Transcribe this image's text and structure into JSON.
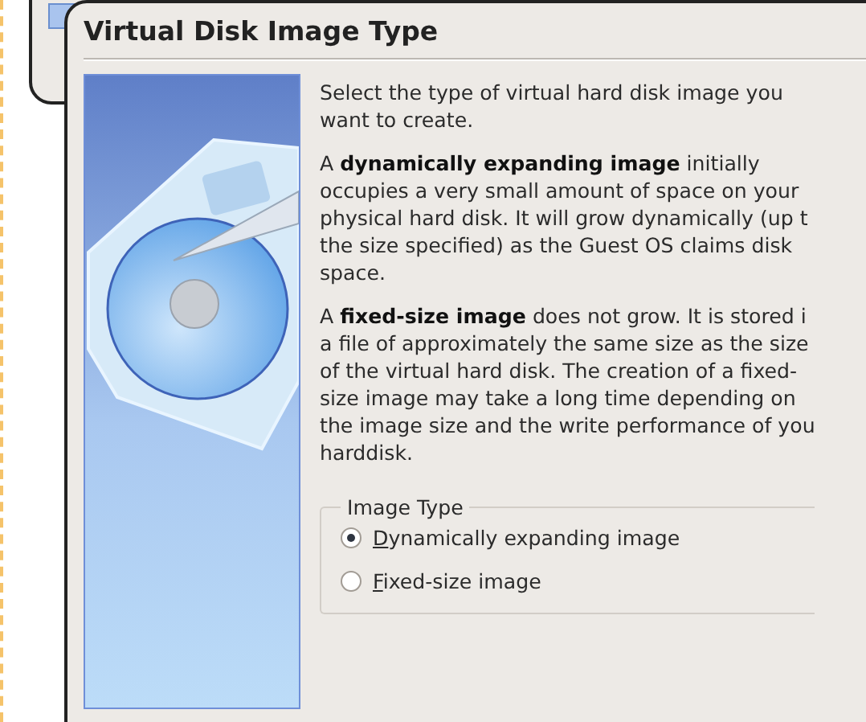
{
  "dialog": {
    "title": "Virtual Disk Image Type",
    "paragraphs": [
      [
        "Select the type of virtual hard disk image you",
        "want to create."
      ],
      [
        "A **dynamically expanding image** initially",
        "occupies a very small amount of space on your",
        "physical hard disk. It will grow dynamically (up t",
        "the size specified) as the Guest OS claims disk",
        "space."
      ],
      [
        "A **fixed-size image** does not grow. It is stored i",
        "a file of approximately the same size as the size",
        "of the virtual hard disk. The creation of a fixed-",
        "size image may take a long time depending on",
        "the image size and the write performance of you",
        "harddisk."
      ]
    ],
    "image_type": {
      "label": "Image Type",
      "options": [
        {
          "label": "Dynamically expanding image",
          "selected": true
        },
        {
          "label": "Fixed-size image",
          "selected": false
        }
      ]
    }
  }
}
